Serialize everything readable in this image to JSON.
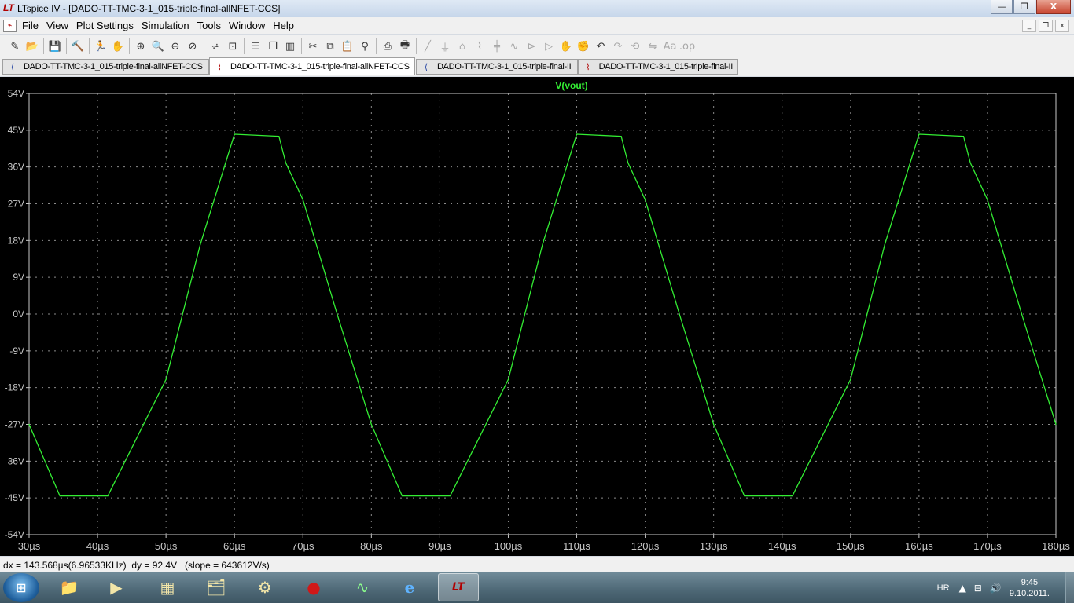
{
  "window": {
    "app_logo": "LT",
    "title": "LTspice IV - [DADO-TT-TMC-3-1_015-triple-final-allNFET-CCS]",
    "minimize": "—",
    "restore": "❐",
    "close": "X"
  },
  "menubar": {
    "items": [
      "File",
      "View",
      "Plot Settings",
      "Simulation",
      "Tools",
      "Window",
      "Help"
    ],
    "mdi_buttons": [
      "_",
      "❐",
      "x"
    ]
  },
  "toolbar": {
    "icons": [
      "new-schematic-icon",
      "open-folder-icon",
      "|",
      "save-icon",
      "|",
      "control-panel-icon",
      "|",
      "run-icon",
      "pan-hand-icon",
      "|",
      "zoom-in-icon",
      "zoom-area-icon",
      "zoom-out-icon",
      "zoom-cancel-icon",
      "|",
      "autorange-icon",
      "zoom-fit-icon",
      "|",
      "tile-horizontal-icon",
      "cascade-icon",
      "tile-vertical-icon",
      "|",
      "cut-icon",
      "copy-icon",
      "paste-icon",
      "find-icon",
      "|",
      "print-preview-icon",
      "print-icon",
      "|",
      "wire-icon",
      "ground-icon",
      "label-icon",
      "resistor-icon",
      "capacitor-icon",
      "inductor-icon",
      "diode-icon",
      "component-icon",
      "move-icon",
      "drag-icon",
      "undo-icon",
      "redo-icon",
      "rotate-icon",
      "mirror-icon",
      "text-icon",
      "spice-directive-icon"
    ]
  },
  "tabs": [
    {
      "label": "DADO-TT-TMC-3-1_015-triple-final-allNFET-CCS",
      "kind": "schematic",
      "active": false
    },
    {
      "label": "DADO-TT-TMC-3-1_015-triple-final-allNFET-CCS",
      "kind": "waveform",
      "active": true
    },
    {
      "label": "DADO-TT-TMC-3-1_015-triple-final-II",
      "kind": "schematic",
      "active": false
    },
    {
      "label": "DADO-TT-TMC-3-1_015-triple-final-II",
      "kind": "waveform",
      "active": false
    }
  ],
  "chart_data": {
    "type": "line",
    "title": "V(vout)",
    "xlabel": "",
    "ylabel": "",
    "xlim": [
      30,
      180
    ],
    "ylim": [
      -54,
      54
    ],
    "x_unit": "µs",
    "y_unit": "V",
    "x_ticks": [
      "30µs",
      "40µs",
      "50µs",
      "60µs",
      "70µs",
      "80µs",
      "90µs",
      "100µs",
      "110µs",
      "120µs",
      "130µs",
      "140µs",
      "150µs",
      "160µs",
      "170µs",
      "180µs"
    ],
    "y_ticks": [
      "54V",
      "45V",
      "36V",
      "27V",
      "18V",
      "9V",
      "0V",
      "-9V",
      "-18V",
      "-27V",
      "-36V",
      "-45V",
      "-54V"
    ],
    "grid": true,
    "background": "#000000",
    "trace_color": "#33ee33",
    "axis_color": "#c8c8c8",
    "series": [
      {
        "name": "V(vout)",
        "x": [
          30,
          34.5,
          41.5,
          50,
          55,
          60,
          66.5,
          67.5,
          70,
          75,
          80,
          84.5,
          91.5,
          100,
          105,
          110,
          116.5,
          117.5,
          120,
          125,
          130,
          134.5,
          141.5,
          150,
          155,
          160,
          166.5,
          167.5,
          170,
          175,
          180
        ],
        "y": [
          -27,
          -44.5,
          -44.5,
          -16,
          17,
          44,
          43.5,
          37,
          28,
          0,
          -27,
          -44.5,
          -44.5,
          -16,
          17,
          44,
          43.5,
          37,
          28,
          0,
          -27,
          -44.5,
          -44.5,
          -16,
          17,
          44,
          43.5,
          37,
          28,
          0,
          -27
        ]
      }
    ]
  },
  "statusbar": {
    "text": "dx = 143.568µs(6.96533KHz)  dy = 92.4V   (slope = 643612V/s)"
  },
  "taskbar": {
    "start_icon": "windows-logo-icon",
    "apps": [
      {
        "name": "explorer-icon",
        "glyph": "📁"
      },
      {
        "name": "media-player-icon",
        "glyph": "▶"
      },
      {
        "name": "office-icon",
        "glyph": "▦"
      },
      {
        "name": "folder-icon",
        "glyph": "🗂"
      },
      {
        "name": "pump-icon",
        "glyph": "⚙"
      },
      {
        "name": "security-icon",
        "glyph": "●"
      },
      {
        "name": "oscilloscope-icon",
        "glyph": "∿"
      },
      {
        "name": "internet-explorer-icon",
        "glyph": "e"
      },
      {
        "name": "ltspice-icon",
        "glyph": "LT"
      }
    ],
    "tray": {
      "language": "HR",
      "time": "9:45",
      "date": "9.10.2011."
    }
  }
}
